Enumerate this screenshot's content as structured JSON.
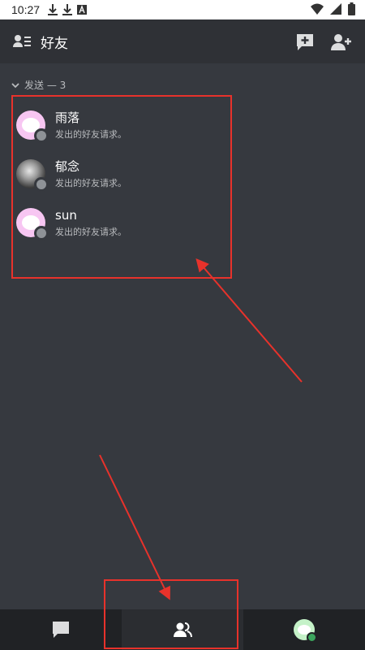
{
  "status_bar": {
    "time": "10:27",
    "left_icons": [
      "download-icon",
      "download-icon",
      "a-icon"
    ],
    "right_icons": [
      "wifi-icon",
      "signal-icon",
      "battery-icon"
    ]
  },
  "header": {
    "title": "好友",
    "left_icon": "friends-list-icon",
    "right_icons": [
      "new-message-icon",
      "add-friend-icon"
    ]
  },
  "section": {
    "label": "发送 — 3",
    "friends": [
      {
        "name": "雨落",
        "subtitle": "发出的好友请求。"
      },
      {
        "name": "郁念",
        "subtitle": "发出的好友请求。"
      },
      {
        "name": "sun",
        "subtitle": "发出的好友请求。"
      }
    ]
  },
  "bottom_nav": {
    "items": [
      "messages-icon",
      "friends-icon",
      "profile-avatar"
    ]
  },
  "colors": {
    "background": "#36393f",
    "header": "#2f3136",
    "nav": "#202225",
    "annotation": "#e8322b",
    "online": "#3ba55d"
  }
}
